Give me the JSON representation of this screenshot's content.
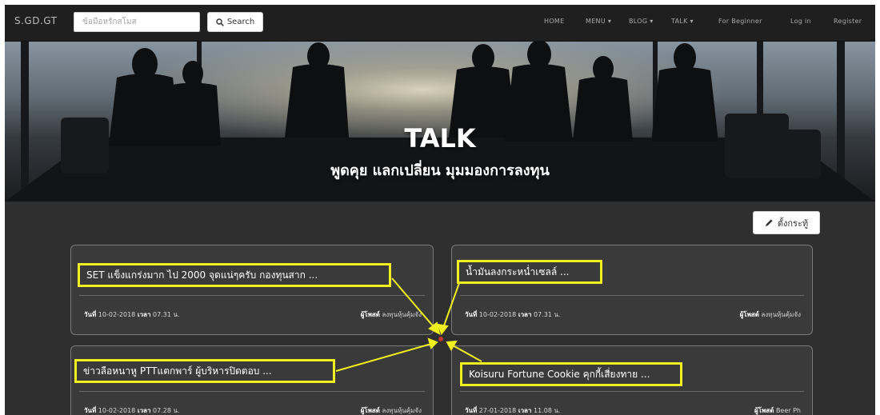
{
  "navbar": {
    "brand": "S.GD.GT",
    "search_placeholder": "ข้อมือหรักสโมส",
    "search_button": "Search",
    "links": [
      "HOME",
      "MENU ▾",
      "BLOG ▾",
      "TALK ▾",
      "For Beginner",
      "Log in",
      "Register"
    ]
  },
  "banner": {
    "title": "TALK",
    "subtitle": "พูดคุย แลกเปลี่ยน มุมมองการลงทุน"
  },
  "new_topic_button": "ตั้งกระทู้",
  "cards": [
    {
      "title": "SET แข็งแกร่งมาก ไป 2000 จุดแน่ๆครับ กองทุนสาก ...",
      "date_label": "วันที่",
      "date": "10-02-2018",
      "time_label": "เวลา",
      "time": "07.31 น.",
      "author_label": "ผู้โพสต์",
      "author": "ลงทุนหุ้นคุ้มจัง"
    },
    {
      "title": "น้ำมันลงกระหน่ำเซลล์ ...",
      "date_label": "วันที่",
      "date": "10-02-2018",
      "time_label": "เวลา",
      "time": "07.31 น.",
      "author_label": "ผู้โพสต์",
      "author": "ลงทุนหุ้นคุ้มจัง"
    },
    {
      "title": "ข่าวลือหนาหู PTTแตกพาร์ ผู้บริหารปิดตอบ ...",
      "date_label": "วันที่",
      "date": "10-02-2018",
      "time_label": "เวลา",
      "time": "07.28 น.",
      "author_label": "ผู้โพสต์",
      "author": "ลงทุนหุ้นคุ้มจัง"
    },
    {
      "title": "Koisuru Fortune Cookie คุกกี้เสี่ยงทาย ...",
      "date_label": "วันที่",
      "date": "27-01-2018",
      "time_label": "เวลา",
      "time": "11.08 น.",
      "author_label": "ผู้โพสต์",
      "author": "Beer Ph"
    }
  ],
  "colors": {
    "highlight": "#f0f01e",
    "background": "#2f2f2f",
    "navbar": "#1f1f1f",
    "card": "#3a3a3a"
  }
}
